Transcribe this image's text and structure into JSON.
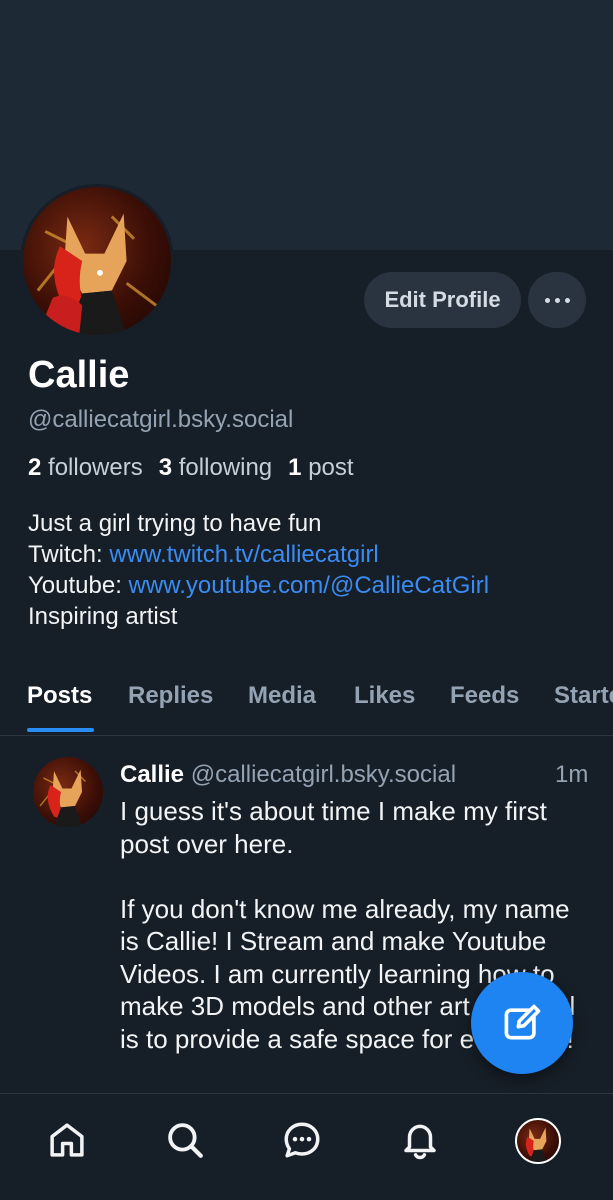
{
  "profile": {
    "display_name": "Callie",
    "handle": "@calliecatgirl.bsky.social",
    "edit_label": "Edit Profile",
    "stats": {
      "followers_count": "2",
      "followers_label": "followers",
      "following_count": "3",
      "following_label": "following",
      "posts_count": "1",
      "posts_label": "post"
    },
    "bio": {
      "line1": "Just a girl trying to have fun",
      "twitch_prefix": "Twitch: ",
      "twitch_link": "www.twitch.tv/calliecatgirl",
      "youtube_prefix": "Youtube: ",
      "youtube_link": "www.youtube.com/@CallieCatGirl",
      "line4": "Inspiring artist"
    }
  },
  "tabs": [
    {
      "label": "Posts",
      "active": true
    },
    {
      "label": "Replies"
    },
    {
      "label": "Media"
    },
    {
      "label": "Likes"
    },
    {
      "label": "Feeds"
    },
    {
      "label": "Starter Packs"
    }
  ],
  "post": {
    "author_name": "Callie",
    "author_handle": "@calliecatgirl.bsky.social",
    "time": "1m",
    "text": "I guess it's about time I make my first post over here.\n\nIf you don't know me already, my name is Callie! I Stream and make Youtube Videos. I am currently learning how to make 3D models and other art. My goal is to provide a safe space for everyone!"
  },
  "nav": {
    "icons": [
      "home-icon",
      "search-icon",
      "chat-icon",
      "bell-icon",
      "profile-avatar"
    ]
  },
  "colors": {
    "background": "#161e27",
    "banner": "#1e2936",
    "accent": "#1d84f2",
    "link": "#3b8cf2"
  }
}
